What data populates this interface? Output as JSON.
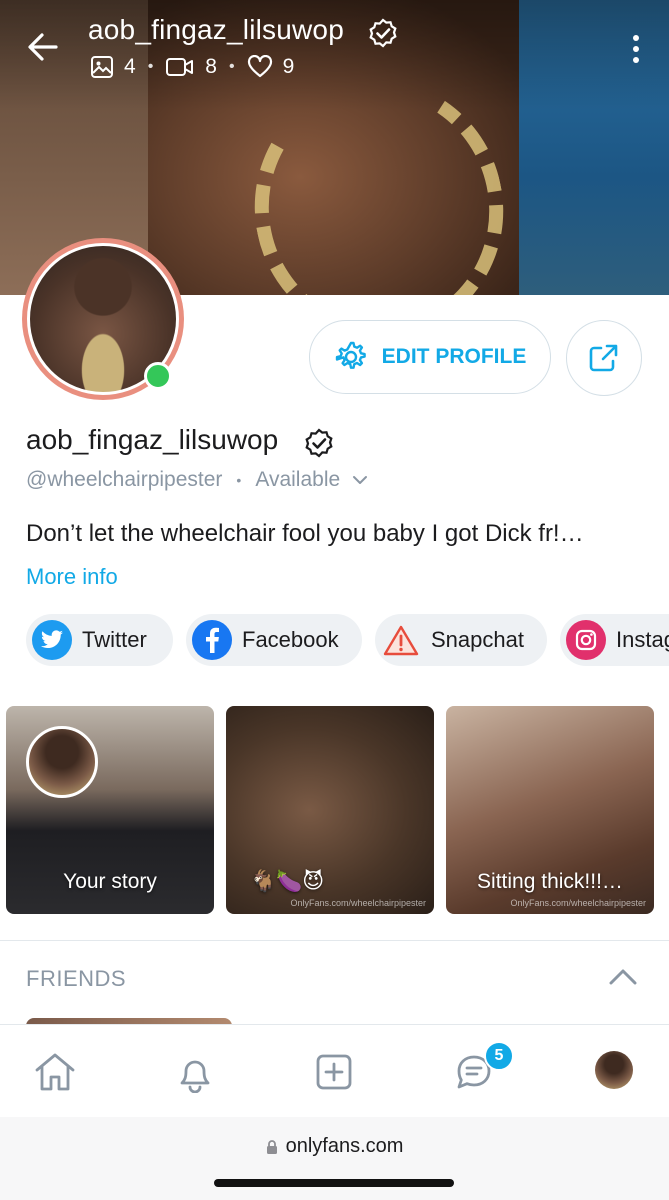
{
  "header": {
    "title": "aob_fingaz_lilsuwop",
    "stats": {
      "photos": "4",
      "videos": "8",
      "likes": "9"
    }
  },
  "profile": {
    "name": "aob_fingaz_lilsuwop",
    "handle": "@wheelchairpipester",
    "status": "Available",
    "bio": "Don’t let the wheelchair fool you baby I got Dick fr!…",
    "more_info": "More info",
    "edit_profile": "EDIT PROFILE"
  },
  "socials": [
    {
      "label": "Twitter",
      "color": "#1d9bf0"
    },
    {
      "label": "Facebook",
      "color": "#1877f2"
    },
    {
      "label": "Snapchat",
      "color": "#e74c3c"
    },
    {
      "label": "Instag",
      "color": "#e1306c"
    }
  ],
  "stories": [
    {
      "caption": "Your story"
    },
    {
      "caption": "🐐🍆😈",
      "watermark": "OnlyFans.com/wheelchairpipester"
    },
    {
      "caption": "Sitting thick!!!…",
      "watermark": "OnlyFans.com/wheelchairpipester"
    }
  ],
  "friends": {
    "title": "FRIENDS"
  },
  "nav": {
    "messages_badge": "5"
  },
  "browser": {
    "url": "onlyfans.com"
  },
  "colors": {
    "accent": "#12a9e6",
    "online": "#34c759",
    "muted": "#8a96a3"
  }
}
